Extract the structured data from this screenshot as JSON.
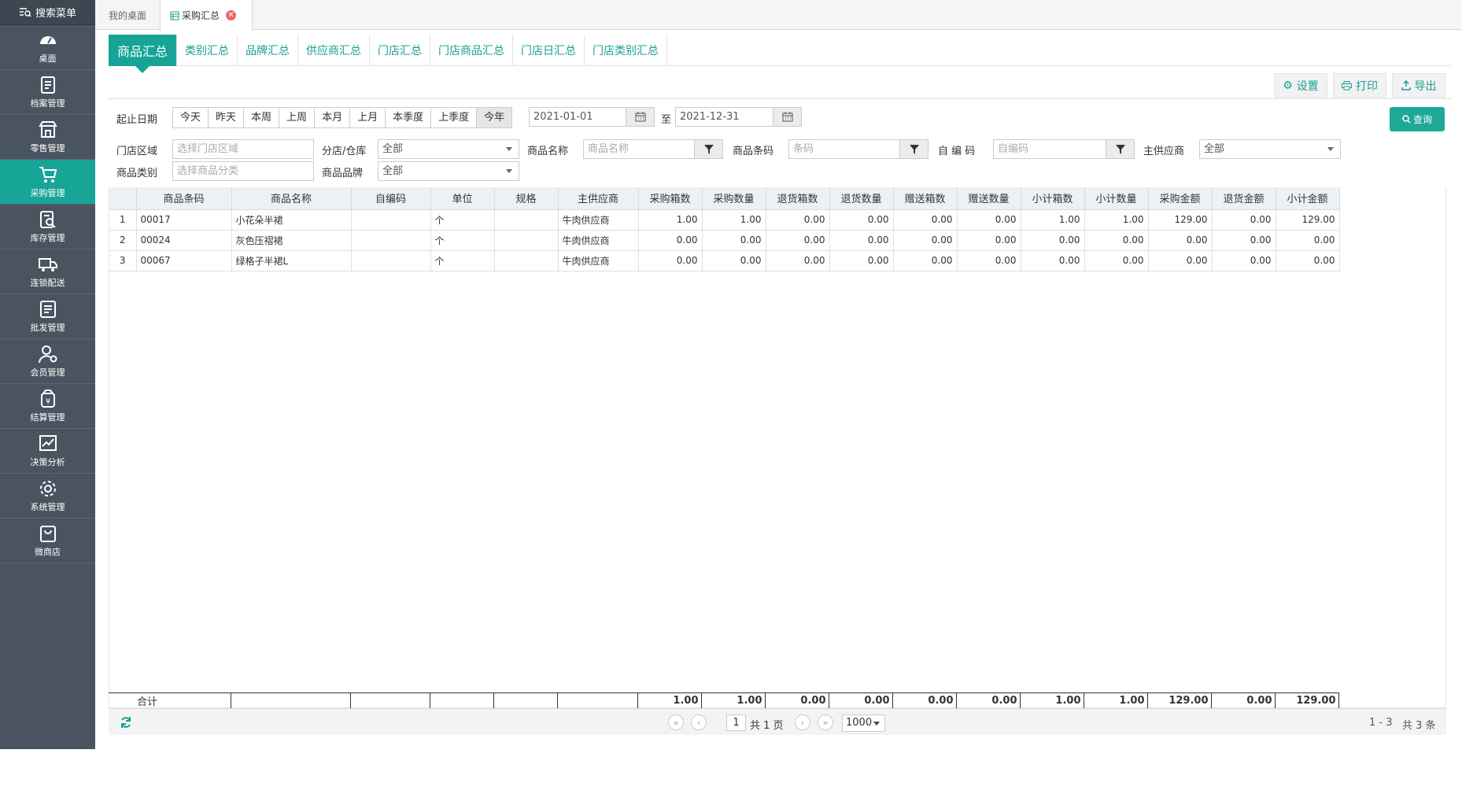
{
  "sidebar": {
    "search_label": "搜索菜单",
    "items": [
      {
        "label": "桌面",
        "icon": "dashboard-icon"
      },
      {
        "label": "档案管理",
        "icon": "archive-icon"
      },
      {
        "label": "零售管理",
        "icon": "store-icon"
      },
      {
        "label": "采购管理",
        "icon": "cart-icon"
      },
      {
        "label": "库存管理",
        "icon": "inventory-icon"
      },
      {
        "label": "连锁配送",
        "icon": "truck-icon"
      },
      {
        "label": "批发管理",
        "icon": "wholesale-icon"
      },
      {
        "label": "会员管理",
        "icon": "member-icon"
      },
      {
        "label": "结算管理",
        "icon": "settlement-icon"
      },
      {
        "label": "决策分析",
        "icon": "chart-icon"
      },
      {
        "label": "系统管理",
        "icon": "gear-icon"
      },
      {
        "label": "微商店",
        "icon": "shop-bag-icon"
      }
    ],
    "active_index": 3
  },
  "top_tabs": [
    {
      "label": "我的桌面"
    },
    {
      "label": "采购汇总",
      "closable": true
    }
  ],
  "sub_tabs": [
    "商品汇总",
    "类别汇总",
    "品牌汇总",
    "供应商汇总",
    "门店汇总",
    "门店商品汇总",
    "门店日汇总",
    "门店类别汇总"
  ],
  "toolbar": {
    "settings": "设置",
    "print": "打印",
    "export": "导出"
  },
  "filters": {
    "date_label": "起止日期",
    "date_buttons": [
      "今天",
      "昨天",
      "本周",
      "上周",
      "本月",
      "上月",
      "本季度",
      "上季度",
      "今年"
    ],
    "date_from": "2021-01-01",
    "to_label": "至",
    "date_to": "2021-12-31",
    "store_area_label": "门店区域",
    "store_area_placeholder": "选择门店区域",
    "branch_label": "分店/仓库",
    "branch_value": "全部",
    "product_name_label": "商品名称",
    "product_name_placeholder": "商品名称",
    "barcode_label": "商品条码",
    "barcode_placeholder": "条码",
    "self_code_label": "自 编 码",
    "self_code_placeholder": "自编码",
    "supplier_label": "主供应商",
    "supplier_value": "全部",
    "category_label": "商品类别",
    "category_placeholder": "选择商品分类",
    "brand_label": "商品品牌",
    "brand_value": "全部",
    "query_label": "查询"
  },
  "table": {
    "columns": [
      "商品条码",
      "商品名称",
      "自编码",
      "单位",
      "规格",
      "主供应商",
      "采购箱数",
      "采购数量",
      "退货箱数",
      "退货数量",
      "赠送箱数",
      "赠送数量",
      "小计箱数",
      "小计数量",
      "采购金额",
      "退货金额",
      "小计金额"
    ],
    "rows": [
      [
        "1",
        "00017",
        "小花朵半裙",
        "",
        "个",
        "",
        "牛肉供应商",
        "1.00",
        "1.00",
        "0.00",
        "0.00",
        "0.00",
        "0.00",
        "1.00",
        "1.00",
        "129.00",
        "0.00",
        "129.00"
      ],
      [
        "2",
        "00024",
        "灰色压褶裙",
        "",
        "个",
        "",
        "牛肉供应商",
        "0.00",
        "0.00",
        "0.00",
        "0.00",
        "0.00",
        "0.00",
        "0.00",
        "0.00",
        "0.00",
        "0.00",
        "0.00"
      ],
      [
        "3",
        "00067",
        "绿格子半裙L",
        "",
        "个",
        "",
        "牛肉供应商",
        "0.00",
        "0.00",
        "0.00",
        "0.00",
        "0.00",
        "0.00",
        "0.00",
        "0.00",
        "0.00",
        "0.00",
        "0.00"
      ]
    ],
    "footer": [
      "合计",
      "",
      "",
      "",
      "",
      "",
      "1.00",
      "1.00",
      "0.00",
      "0.00",
      "0.00",
      "0.00",
      "1.00",
      "1.00",
      "129.00",
      "0.00",
      "129.00"
    ]
  },
  "pager": {
    "page": "1",
    "total_pages_label": "共 1 页",
    "page_size": "1000",
    "range_label": "1 - 3",
    "total_label": "共 3 条"
  },
  "colors": {
    "accent": "#17a497",
    "sidebar": "#4a5460"
  }
}
